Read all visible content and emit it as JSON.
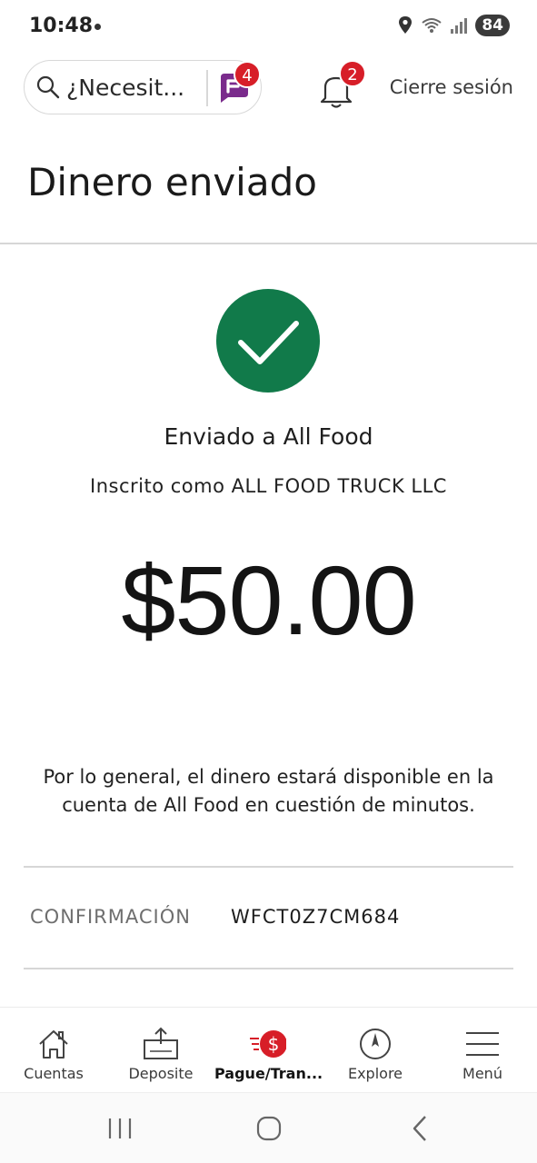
{
  "status_bar": {
    "time": "10:48",
    "battery": "84"
  },
  "header": {
    "search_placeholder": "¿Necesit...",
    "fargo_badge": "4",
    "notifications_badge": "2",
    "logout_label": "Cierre sesión"
  },
  "page": {
    "title": "Dinero enviado"
  },
  "confirmation": {
    "sent_to": "Enviado a All Food",
    "enrolled_as": "Inscrito como ALL FOOD TRUCK LLC",
    "amount": "$50.00",
    "info_message": "Por lo general, el dinero estará disponible en la cuenta de All Food en cuestión de minutos.",
    "confirmation_label": "CONFIRMACIÓN",
    "confirmation_number": "WFCT0Z7CM684"
  },
  "colors": {
    "success_green": "#117a4a",
    "badge_red": "#d71e28",
    "fargo_purple": "#7a2b8c"
  },
  "bottom_nav": {
    "items": [
      {
        "label": "Cuentas",
        "icon": "home-icon"
      },
      {
        "label": "Deposite",
        "icon": "deposit-icon"
      },
      {
        "label": "Pague/Tran...",
        "icon": "pay-transfer-icon"
      },
      {
        "label": "Explore",
        "icon": "compass-icon"
      },
      {
        "label": "Menú",
        "icon": "menu-icon"
      }
    ]
  },
  "android_nav": [
    "recents-icon",
    "home-circle-icon",
    "back-icon"
  ]
}
